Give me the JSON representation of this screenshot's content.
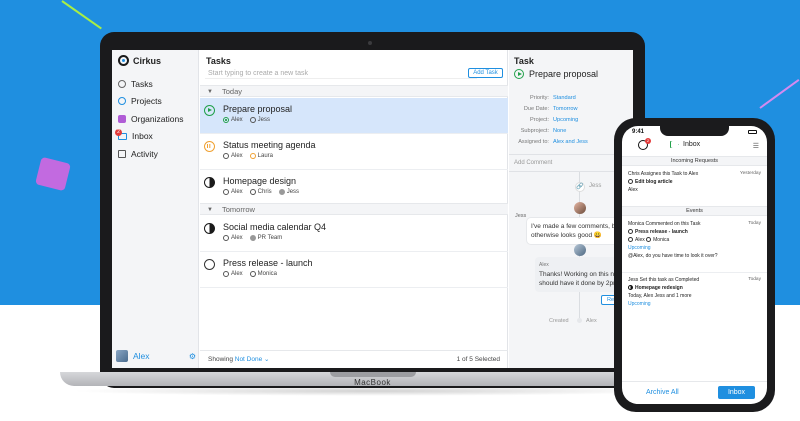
{
  "colors": {
    "accent": "#1f8fe0",
    "background": "#1f8fe0",
    "green": "#22a04a",
    "orange": "#f0a132"
  },
  "device_label": "MacBook",
  "app": {
    "name": "Cirkus"
  },
  "sidebar": {
    "items": [
      {
        "label": "Tasks",
        "icon": "circle-icon"
      },
      {
        "label": "Projects",
        "icon": "circle-icon"
      },
      {
        "label": "Organizations",
        "icon": "organizations-icon"
      },
      {
        "label": "Inbox",
        "icon": "inbox-icon",
        "badge": "2"
      },
      {
        "label": "Activity",
        "icon": "activity-icon"
      }
    ],
    "user": "Alex"
  },
  "tasks": {
    "title": "Tasks",
    "new_placeholder": "Start typing to create a new task",
    "add_button": "Add Task",
    "sections": [
      "Today",
      "Tomorrow"
    ],
    "rows": [
      {
        "name": "Prepare proposal",
        "people": [
          "Alex",
          "Jess"
        ]
      },
      {
        "name": "Status meeting agenda",
        "people": [
          "Alex",
          "Laura"
        ]
      },
      {
        "name": "Homepage design",
        "people": [
          "Alex",
          "Chris",
          "Jess"
        ]
      },
      {
        "name": "Social media calendar Q4",
        "people": [
          "Alex",
          "PR Team"
        ]
      },
      {
        "name": "Press release - launch",
        "people": [
          "Alex",
          "Monica"
        ]
      }
    ],
    "footer": {
      "showing": "Showing",
      "filter": "Not Done",
      "count": "1 of 5 Selected"
    }
  },
  "detail": {
    "title": "Task",
    "task_name": "Prepare proposal",
    "props": [
      {
        "k": "Priority:",
        "v": "Standard"
      },
      {
        "k": "Due Date:",
        "v": "Tomorrow"
      },
      {
        "k": "Project:",
        "v": "Upcoming"
      },
      {
        "k": "Subproject:",
        "v": "None"
      },
      {
        "k": "Assigned to:",
        "v": "Alex and Jess"
      }
    ],
    "add_comment": "Add Comment",
    "jess_top": "Jess",
    "jess_label": "Jess",
    "comment1": "I've made a few comments, but otherwise looks good 😀",
    "comment2_who": "Alex",
    "comment2": "Thanks! Working on this now should have it done by 2pm.",
    "reply": "Reply",
    "created": "Created",
    "created_by": "Alex"
  },
  "phone": {
    "time": "9:41",
    "badge": "2",
    "title": "Inbox",
    "incoming": "Incoming Requests",
    "req_title": "Chris Assignes this Task to Alex",
    "req_when": "Yesterday",
    "req_task": "Edit blog article",
    "req_person": "Alex",
    "events": "Events",
    "e1_title": "Monica Commented on this Task",
    "e1_when": "Today",
    "e1_task": "Press release - launch",
    "e1_people": [
      "Alex",
      "Monica"
    ],
    "e1_project": "Upcoming",
    "e1_comment": "@Alex, do you have time to look it over?",
    "e2_title": "Jess Set this task as Completed",
    "e2_when": "Today",
    "e2_task": "Homepage redesign",
    "e2_meta": "Today, Alex Jess and 1 more",
    "e2_project": "Upcoming",
    "archive": "Archive All",
    "inbox_btn": "Inbox"
  }
}
